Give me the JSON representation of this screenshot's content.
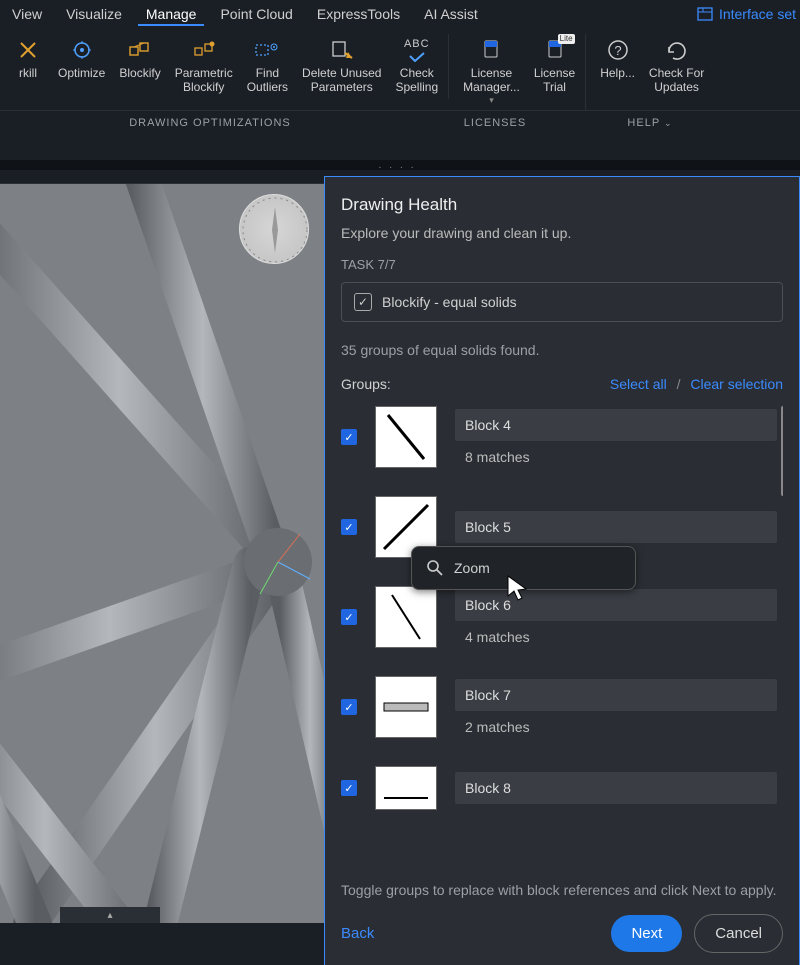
{
  "menu": {
    "items": [
      "View",
      "Visualize",
      "Manage",
      "Point Cloud",
      "ExpressTools",
      "AI Assist"
    ],
    "active_index": 2,
    "interface_set": "Interface set"
  },
  "ribbon": {
    "buttons": [
      {
        "label": "rkill"
      },
      {
        "label": "Optimize"
      },
      {
        "label": "Blockify"
      },
      {
        "label": "Parametric\nBlockify"
      },
      {
        "label": "Find\nOutliers"
      },
      {
        "label": "Delete Unused\nParameters"
      },
      {
        "label": "Check\nSpelling",
        "badge": "ABC"
      },
      {
        "label": "License\nManager..."
      },
      {
        "label": "License\nTrial",
        "badge": "Lite"
      },
      {
        "label": "Help..."
      },
      {
        "label": "Check For\nUpdates"
      }
    ],
    "group_labels": [
      "DRAWING OPTIMIZATIONS",
      "LICENSES",
      "HELP"
    ]
  },
  "panel": {
    "title": "Drawing Health",
    "subtitle": "Explore your drawing and clean it up.",
    "task_label": "TASK 7/7",
    "task_name": "Blockify - equal solids",
    "found": "35 groups of equal solids found.",
    "groups_label": "Groups:",
    "select_all": "Select all",
    "clear_selection": "Clear selection",
    "hint": "Toggle groups to replace with block references and click Next to apply.",
    "back": "Back",
    "next": "Next",
    "cancel": "Cancel",
    "context_zoom": "Zoom",
    "groups": [
      {
        "name": "Block 4",
        "matches": "8 matches",
        "checked": true,
        "thumb": "diag-nw"
      },
      {
        "name": "Block 5",
        "matches": "",
        "checked": true,
        "thumb": "diag-ne"
      },
      {
        "name": "Block 6",
        "matches": "4 matches",
        "checked": true,
        "thumb": "diag-nw-thin"
      },
      {
        "name": "Block 7",
        "matches": "2 matches",
        "checked": true,
        "thumb": "hbar"
      },
      {
        "name": "Block 8",
        "matches": "",
        "checked": true,
        "thumb": "hline"
      }
    ]
  }
}
